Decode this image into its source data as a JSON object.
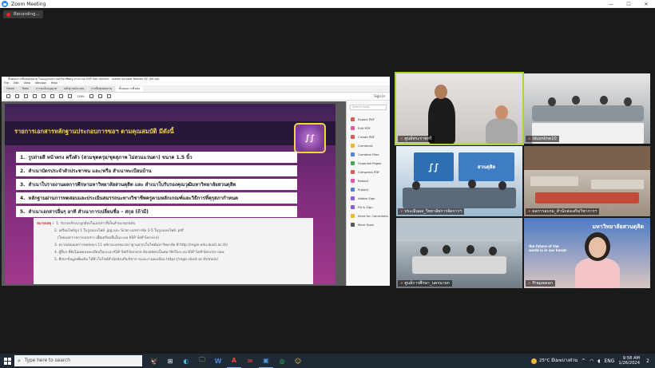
{
  "zoom": {
    "window_title": "Zoom Meeting",
    "controls": [
      "—",
      "☐",
      "✕"
    ],
    "recording_label": "Recording..."
  },
  "acrobat": {
    "title": "ขั้นตอนการยื่นขอต่ออายุ ใบอนุญาตประกอบวิชาชีพครู ผ่านระบบ KSP Self-Service - Adobe Acrobat Reader DC (64-bit)",
    "menu": [
      "File",
      "Edit",
      "View",
      "Window",
      "Help"
    ],
    "tabs": [
      "Home",
      "Tools",
      "การขอใบอนุญาต",
      "หลักฐานประกอบ",
      "การยื่นขอต่ออายุ",
      "ขั้นตอนการยื่นขอ"
    ],
    "zoom_level": "126%",
    "sign_in": "Sign In",
    "search_placeholder": "Search tools",
    "tools": [
      {
        "label": "Export PDF",
        "color": "#e05a5a"
      },
      {
        "label": "Edit PDF",
        "color": "#e05aa8"
      },
      {
        "label": "Create PDF",
        "color": "#e05a5a"
      },
      {
        "label": "Comment",
        "color": "#f2b630"
      },
      {
        "label": "Combine Files",
        "color": "#5a7be0"
      },
      {
        "label": "Organize Pages",
        "color": "#3da85a"
      },
      {
        "label": "Compress PDF",
        "color": "#e05a5a"
      },
      {
        "label": "Redact",
        "color": "#e05aa8"
      },
      {
        "label": "Protect",
        "color": "#5a7be0"
      },
      {
        "label": "Adobe Sign",
        "color": "#8a5ae0"
      },
      {
        "label": "Fill & Sign",
        "color": "#8a5ae0"
      },
      {
        "label": "Send for Comments",
        "color": "#f2b630"
      },
      {
        "label": "More Tools",
        "color": "#555555"
      }
    ]
  },
  "slide": {
    "title": "รายการเอกสารหลักฐานประกอบการขอฯ ตามคุณสมบัติ มีดังนี้",
    "logo_text": "∫∫",
    "items": [
      {
        "num": "1.",
        "text": "รูปถ่ายสี หน้าตรง ครึ่งตัว (สวมชุดครุย/ชุดสุภาพ ไม่สวมแว่นตา) ขนาด 1.5 นิ้ว"
      },
      {
        "num": "2.",
        "text": "สำเนาบัตรประจำตัวประชาชน และ/หรือ สำเนาทะเบียนบ้าน"
      },
      {
        "num": "3.",
        "text": "สำเนาใบรายงานผลการศึกษามหาวิทยาลัยสวนดุสิต และ สำเนาใบรับรองคุณวุฒิมหาวิทยาลัยสวนดุสิต"
      },
      {
        "num": "4.",
        "text": "หลักฐานผ่านการทดสอบและประเมินสมรรถนะทางวิชาชีพครูตามหลักเกณฑ์และวิธีการที่คุรุสภากำหนด"
      },
      {
        "num": "5.",
        "text": "สำเนาเอกสารอื่นๆ อาทิ สำเนาการเปลี่ยนชื่อ – สกุล (ถ้ามี)"
      }
    ],
    "note_label": "หมายเหตุ :",
    "notes": [
      "1. รับรองสำเนาถูกต้องในเอกสารที่เป็นสำเนาทุกฉบับ",
      "2. เตรียมไฟล์รูป 1 ใบรูปแบบไฟล์ .jpg และ Scan เอกสารข้อ 2-5 ในรูปแบบไฟล์ .pdf",
      "(โดยแยกรายการเอกสาร เพื่อเตรียมยื่นในระบบ KSP Self-Service)",
      "3. ตรวจสอบผลการทดสอบฯ 11 หลักรองเลขมาตราฐานจากเว็บไซต์มหาวิทยาลัย ที่ http://regis-edu.dusit.ac.th/",
      "4. ผู้ยื่นฯ ที่ยังไม่เคยลงทะเบียนในระบบ KSP Self-Service ต้องสมัครเป็นสมาชิกในระบบ KSP Self-Service ก่อน",
      "5. ศึกษาข้อมูลเพิ่มเติม ได้ที่ เว็บไซต์สำนักส่งเสริมวิชาการและงานทะเบียน https://regis.dusit.ac.th/main/"
    ],
    "footer": "สำนักส่งเสริมวิชาการและงานทะเบียน",
    "page_number": "31"
  },
  "participants": [
    {
      "name": "ศูนย์พระราชทรี"
    },
    {
      "name": "iduonline10"
    },
    {
      "name": "ประเมินผล_วิทยาลัยการจัดการฯ"
    },
    {
      "name": "ผลการอบรม_สำนักส่งเสริมวิชาการฯ"
    },
    {
      "name": "ศูนย์การศึกษา_นครนายก"
    },
    {
      "name": "Prapawan"
    }
  ],
  "tile_texts": {
    "sign_right_top": "มหาวิทยาลัยสวนดุสิต",
    "sign_right_sub": "the future of the world is in our hands",
    "sign_center": "สวนดุสิต"
  },
  "taskbar": {
    "search_placeholder": "Type here to search",
    "apps": [
      "🦅",
      "⊞",
      "◐",
      "🗀",
      "W",
      "A",
      "✉",
      "▣",
      "◎",
      "☺"
    ],
    "weather": "25°C มีเมฆบางส่วน",
    "time": "9:58 AM",
    "date": "1/26/2024",
    "language": "ENG",
    "notifications": "2"
  }
}
